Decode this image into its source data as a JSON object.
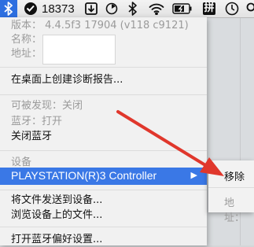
{
  "menubar": {
    "count": "18373",
    "ime_label": "拼"
  },
  "menu": {
    "version": "版本： 4.4.5f3 17904 (v118 c9121)",
    "name_label": "名称：",
    "address_label": "地址：",
    "diagnostic": "在桌面上创建诊断报告...",
    "discoverable": "可被发现：关闭",
    "bluetooth_status": "蓝牙：打开",
    "turn_off": "关闭蓝牙",
    "devices_header": "设备",
    "device": "PLAYSTATION(R)3 Controller",
    "send_file": "将文件发送到设备...",
    "browse_files": "浏览设备上的文件...",
    "open_prefs": "打开蓝牙偏好设置..."
  },
  "submenu": {
    "remove": "移除",
    "address_label": "地址："
  },
  "colors": {
    "highlight": "#3a78e6",
    "arrow": "#e0372c"
  }
}
